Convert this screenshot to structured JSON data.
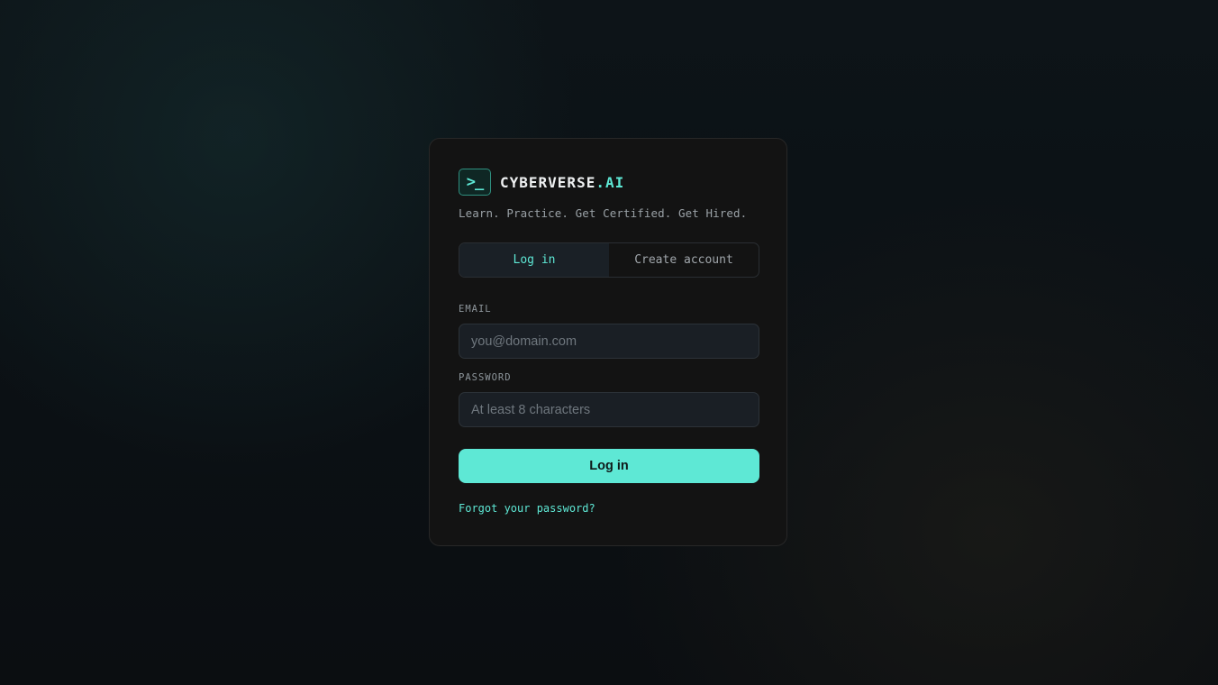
{
  "brand": {
    "logo_glyph": ">_",
    "name": "CYBERVERSE",
    "name_suffix": ".AI",
    "tagline": "Learn. Practice. Get Certified. Get Hired."
  },
  "tabs": [
    {
      "label": "Log in",
      "active": true
    },
    {
      "label": "Create account",
      "active": false
    }
  ],
  "form": {
    "email": {
      "label": "EMAIL",
      "placeholder": "you@domain.com",
      "value": ""
    },
    "password": {
      "label": "PASSWORD",
      "placeholder": "At least 8 characters",
      "value": ""
    },
    "submit_label": "Log in",
    "forgot_label": "Forgot your password?"
  },
  "colors": {
    "accent": "#5ee8d5",
    "card_background": "#131313",
    "page_background": "#0b0f13"
  }
}
